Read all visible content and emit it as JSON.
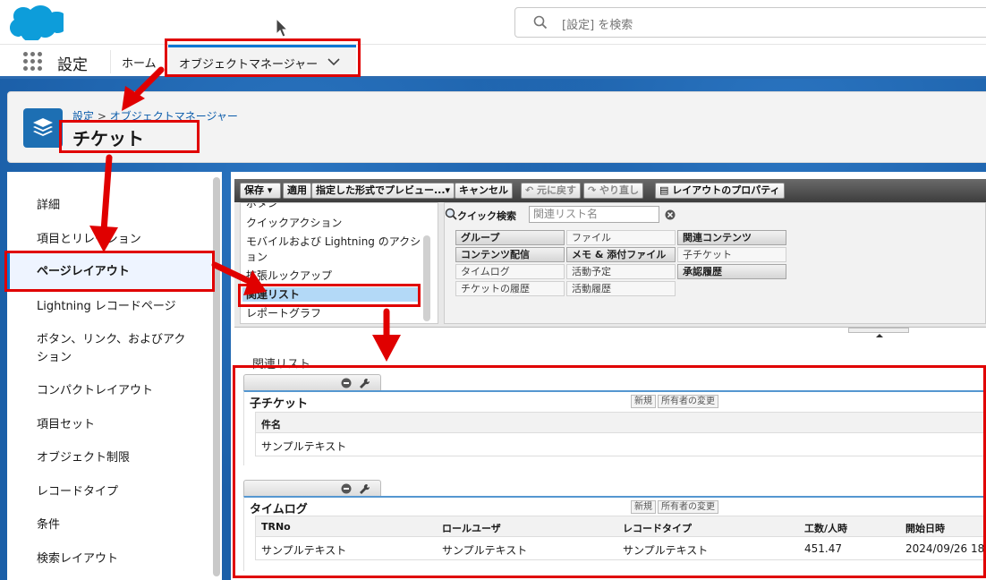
{
  "header": {
    "search_placeholder": "[設定] を検索"
  },
  "nav": {
    "app_name": "設定",
    "home": "ホーム",
    "active_tab": "オブジェクトマネージャー"
  },
  "object_header": {
    "breadcrumb_root": "設定",
    "breadcrumb_sep": ">",
    "breadcrumb_current": "オブジェクトマネージャー",
    "title": "チケット"
  },
  "sidebar": {
    "items": [
      {
        "label": "詳細",
        "active": false
      },
      {
        "label": "項目とリレーション",
        "active": false
      },
      {
        "label": "ページレイアウト",
        "active": true
      },
      {
        "label": "Lightning レコードページ",
        "active": false
      },
      {
        "label": "ボタン、リンク、およびアク",
        "active": false
      },
      {
        "label": "ション",
        "active": false
      },
      {
        "label": "コンパクトレイアウト",
        "active": false
      },
      {
        "label": "項目セット",
        "active": false
      },
      {
        "label": "オブジェクト制限",
        "active": false
      },
      {
        "label": "レコードタイプ",
        "active": false
      },
      {
        "label": "条件",
        "active": false
      },
      {
        "label": "検索レイアウト",
        "active": false
      }
    ]
  },
  "toolbar": {
    "save": "保存",
    "apply": "適用",
    "preview": "指定した形式でプレビュー...",
    "cancel": "キャンセル",
    "undo": "元に戻す",
    "redo": "やり直し",
    "properties": "レイアウトのプロパティ"
  },
  "palette": {
    "categories": [
      "ボタン",
      "クイックアクション",
      "モバイルおよび Lightning のアクシ",
      "ョン",
      "拡張ルックアップ",
      "関連リスト",
      "レポートグラフ"
    ],
    "selected_category": "関連リスト",
    "quick_search_label": "クイック検索",
    "quick_search_placeholder": "関連リスト名",
    "grid": [
      [
        "グループ",
        "ファイル",
        "関連コンテンツ"
      ],
      [
        "コンテンツ配信",
        "メモ & 添付ファイル",
        "子チケット"
      ],
      [
        "タイムログ",
        "活動予定",
        "承認履歴"
      ],
      [
        "チケットの履歴",
        "活動履歴",
        ""
      ]
    ]
  },
  "layout": {
    "section_label": "関連リスト",
    "related_lists": [
      {
        "title": "子チケット",
        "buttons": [
          "新規",
          "所有者の変更"
        ],
        "columns": [
          "件名"
        ],
        "row": [
          "サンプルテキスト"
        ]
      },
      {
        "title": "タイムログ",
        "buttons": [
          "新規",
          "所有者の変更"
        ],
        "columns": [
          "TRNo",
          "ロールユーザ",
          "レコードタイプ",
          "工数/人時",
          "開始日時"
        ],
        "row": [
          "サンプルテキスト",
          "サンプルテキスト",
          "サンプルテキスト",
          "451.47",
          "2024/09/26 18"
        ]
      }
    ]
  },
  "colors": {
    "brand_blue": "#0176d3",
    "annotation_red": "#e00000"
  }
}
